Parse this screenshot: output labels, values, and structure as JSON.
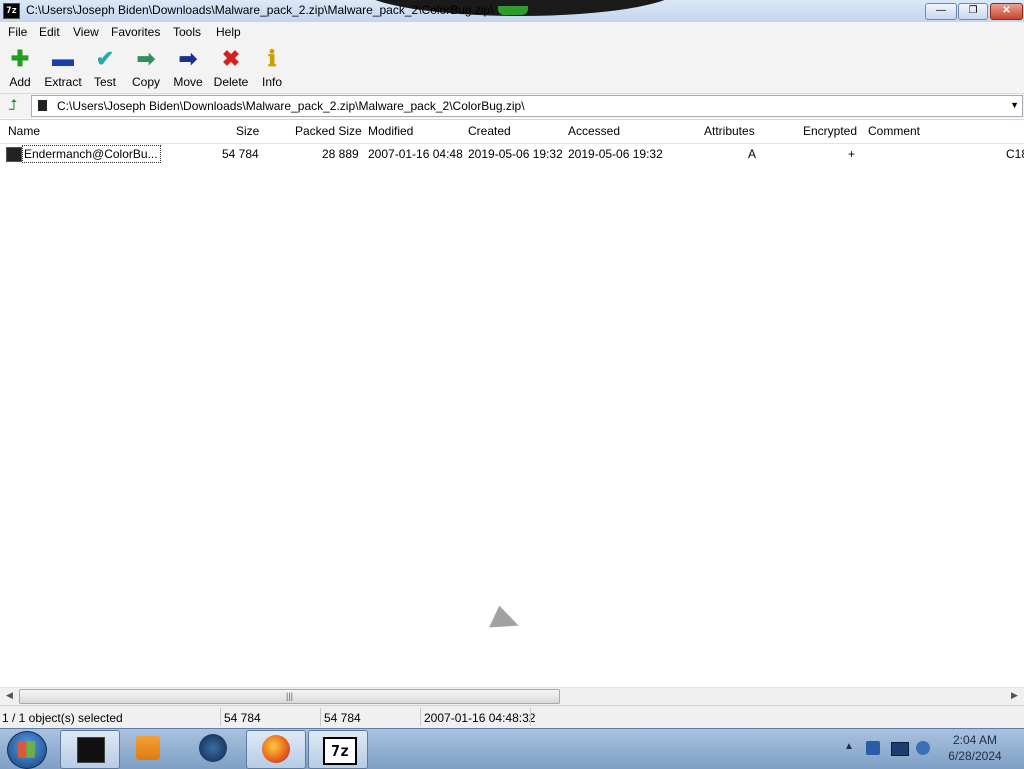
{
  "window": {
    "title": "C:\\Users\\Joseph Biden\\Downloads\\Malware_pack_2.zip\\Malware_pack_2\\ColorBug.zip\\",
    "app_icon_label": "7z",
    "min_glyph": "—",
    "max_glyph": "❐",
    "close_glyph": "✕"
  },
  "menu": [
    "File",
    "Edit",
    "View",
    "Favorites",
    "Tools",
    "Help"
  ],
  "toolbar": {
    "add": {
      "label": "Add",
      "glyph": "✚",
      "color": "#1f9e1f"
    },
    "extract": {
      "label": "Extract",
      "glyph": "▬",
      "color": "#1c3fb0"
    },
    "test": {
      "label": "Test",
      "glyph": "✔",
      "color": "#2ba8a8"
    },
    "copy": {
      "label": "Copy",
      "glyph": "➡",
      "color": "#2f8f5f"
    },
    "move": {
      "label": "Move",
      "glyph": "➡",
      "color": "#1c2f8f"
    },
    "delete": {
      "label": "Delete",
      "glyph": "✖",
      "color": "#d42020"
    },
    "info": {
      "label": "Info",
      "glyph": "ℹ",
      "color": "#c9a100"
    }
  },
  "address": {
    "up_glyph": "⮥",
    "path": "C:\\Users\\Joseph Biden\\Downloads\\Malware_pack_2.zip\\Malware_pack_2\\ColorBug.zip\\",
    "dropdown_glyph": "▼"
  },
  "columns": {
    "name": "Name",
    "size": "Size",
    "packed_size": "Packed Size",
    "modified": "Modified",
    "created": "Created",
    "accessed": "Accessed",
    "attributes": "Attributes",
    "encrypted": "Encrypted",
    "comment": "Comment"
  },
  "rows": [
    {
      "name": "Endermanch@ColorBu...",
      "size": "54 784",
      "packed_size": "28 889",
      "modified": "2007-01-16 04:48",
      "created": "2019-05-06 19:32",
      "accessed": "2019-05-06 19:32",
      "attributes": "A",
      "encrypted": "+",
      "comment": "",
      "overflow": "C18"
    }
  ],
  "scrollbar": {
    "left_glyph": "◀",
    "right_glyph": "▶",
    "grip": "|||"
  },
  "status": {
    "selection": "1 / 1 object(s) selected",
    "size": "54 784",
    "packed": "54 784",
    "modified": "2007-01-16 04:48:32"
  },
  "taskbar": {
    "clock_time": "2:04 AM",
    "clock_date": "6/28/2024",
    "tray_up": "▲",
    "sevenzip_label": "7z"
  }
}
